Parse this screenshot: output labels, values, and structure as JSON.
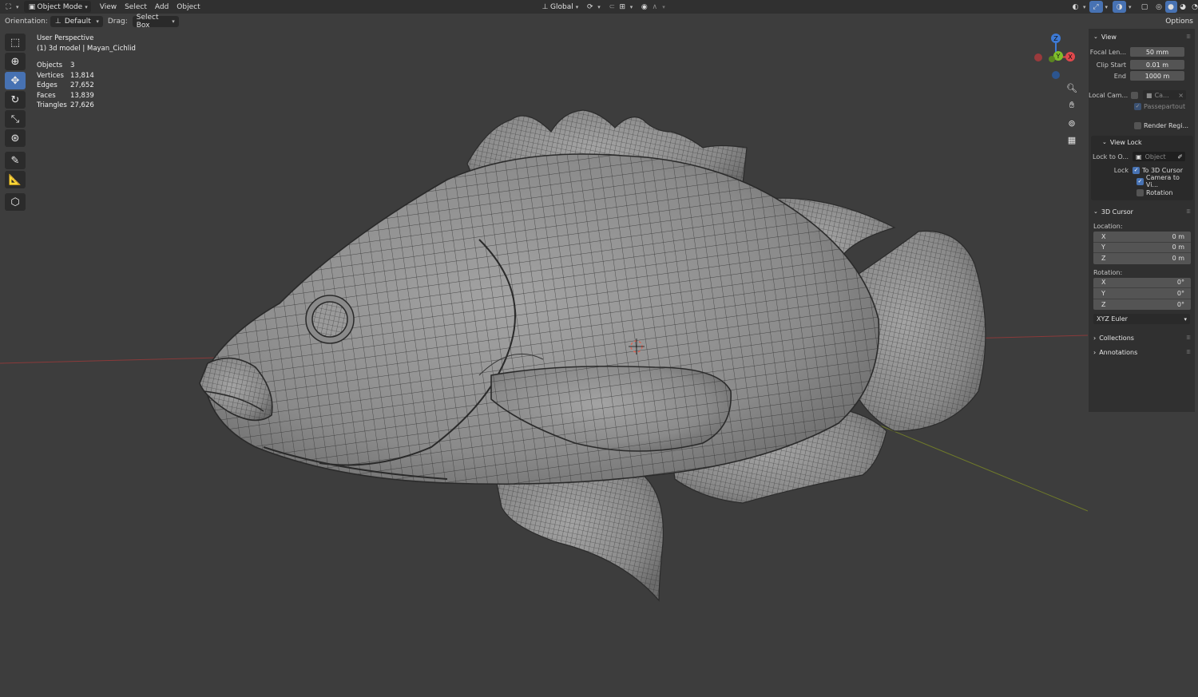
{
  "header": {
    "mode_label": "Object Mode",
    "menus": [
      "View",
      "Select",
      "Add",
      "Object"
    ],
    "transform_orientation": "Global"
  },
  "tool_settings": {
    "orientation_label": "Orientation:",
    "orientation_value": "Default",
    "drag_label": "Drag:",
    "drag_value": "Select Box",
    "options_label": "Options"
  },
  "overlay": {
    "view_name": "User Perspective",
    "object_name": "(1) 3d model | Mayan_Cichlid",
    "stats": [
      {
        "label": "Objects",
        "value": "3"
      },
      {
        "label": "Vertices",
        "value": "13,814"
      },
      {
        "label": "Edges",
        "value": "27,652"
      },
      {
        "label": "Faces",
        "value": "13,839"
      },
      {
        "label": "Triangles",
        "value": "27,626"
      }
    ]
  },
  "gizmo": {
    "x": "X",
    "y": "Y",
    "z": "Z"
  },
  "sidebar": {
    "view": {
      "title": "View",
      "focal_length_label": "Focal Len...",
      "focal_length": "50 mm",
      "clip_start_label": "Clip Start",
      "clip_start": "0.01 m",
      "clip_end_label": "End",
      "clip_end": "1000 m",
      "local_camera_label": "Local Cam...",
      "local_camera_value": "Ca...",
      "passepartout_label": "Passepartout",
      "render_region_label": "Render Regi..."
    },
    "view_lock": {
      "title": "View Lock",
      "lock_to_object_label": "Lock to O...",
      "lock_to_object_placeholder": "Object",
      "lock_label": "Lock",
      "to_3d_cursor": "To 3D Cursor",
      "camera_to_view": "Camera to Vi...",
      "rotation": "Rotation"
    },
    "cursor": {
      "title": "3D Cursor",
      "location_label": "Location:",
      "location": [
        {
          "axis": "X",
          "value": "0 m"
        },
        {
          "axis": "Y",
          "value": "0 m"
        },
        {
          "axis": "Z",
          "value": "0 m"
        }
      ],
      "rotation_label": "Rotation:",
      "rotation": [
        {
          "axis": "X",
          "value": "0°"
        },
        {
          "axis": "Y",
          "value": "0°"
        },
        {
          "axis": "Z",
          "value": "0°"
        }
      ],
      "rotation_mode": "XYZ Euler"
    },
    "collections_title": "Collections",
    "annotations_title": "Annotations"
  },
  "colors": {
    "accent": "#4772b3",
    "viewport_bg": "#3d3d3d",
    "mesh": "#8e8e8e",
    "axis_x": "#e0484c",
    "axis_y": "#7fbf2a",
    "axis_z": "#3d7ad6"
  }
}
